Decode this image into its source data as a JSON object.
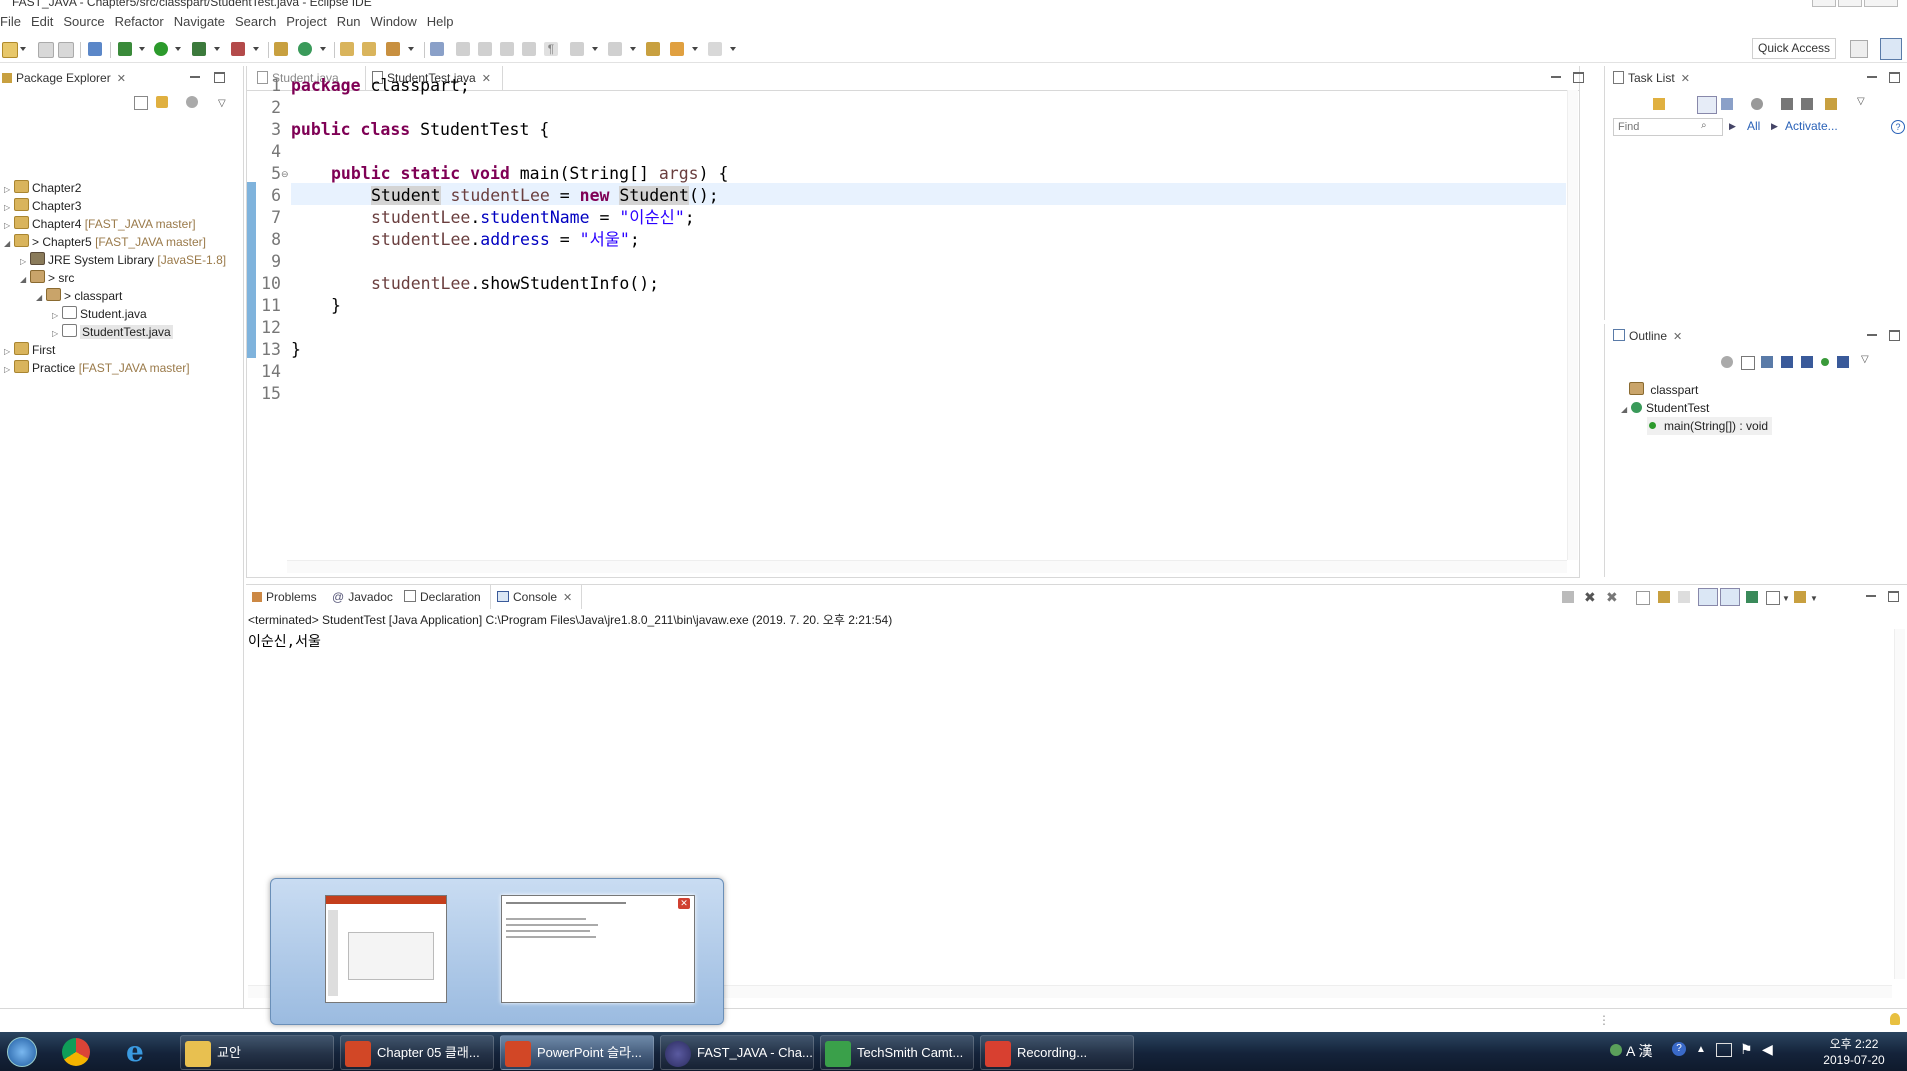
{
  "window": {
    "title": "FAST_JAVA - Chapter5/src/classpart/StudentTest.java - Eclipse IDE"
  },
  "menu": [
    "File",
    "Edit",
    "Source",
    "Refactor",
    "Navigate",
    "Search",
    "Project",
    "Run",
    "Window",
    "Help"
  ],
  "toolbar": {
    "quick_access": "Quick Access"
  },
  "package_explorer": {
    "title": "Package Explorer",
    "items": [
      {
        "label": "Chapter2",
        "repo": ""
      },
      {
        "label": "Chapter3",
        "repo": ""
      },
      {
        "label": "Chapter4",
        "repo": "[FAST_JAVA master]"
      },
      {
        "label": "> Chapter5",
        "repo": "[FAST_JAVA master]"
      },
      {
        "label": "JRE System Library",
        "repo": "[JavaSE-1.8]"
      },
      {
        "label": "> src",
        "repo": ""
      },
      {
        "label": "> classpart",
        "repo": ""
      },
      {
        "label": "Student.java",
        "repo": ""
      },
      {
        "label": "StudentTest.java",
        "repo": ""
      },
      {
        "label": "First",
        "repo": ""
      },
      {
        "label": "Practice",
        "repo": "[FAST_JAVA master]"
      }
    ]
  },
  "editor": {
    "tabs": [
      {
        "label": "Student.java"
      },
      {
        "label": "StudentTest.java"
      }
    ],
    "line_numbers": [
      "1",
      "2",
      "3",
      "4",
      "5",
      "6",
      "7",
      "8",
      "9",
      "10",
      "11",
      "12",
      "13",
      "14",
      "15"
    ],
    "code": {
      "l1_kw": "package",
      "l1_rest": " classpart;",
      "l3_kw": "public class",
      "l3_rest": " StudentTest {",
      "l5_kw": "public static void",
      "l5_mid": " main(String[] ",
      "l5_var": "args",
      "l5_end": ") {",
      "l7_type": "Student",
      "l7_var": "studentLee",
      "l7_eq": " = ",
      "l7_kw": "new",
      "l7_type2": "Student",
      "l7_end": "();",
      "l8_var": "studentLee",
      "l8_field": "studentName",
      "l8_eq": " = ",
      "l8_str": "\"이순신\"",
      "l8_end": ";",
      "l9_var": "studentLee",
      "l9_field": "address",
      "l9_eq": " = ",
      "l9_str": "\"서울\"",
      "l9_end": ";",
      "l11_var": "studentLee",
      "l11_call": ".showStudentInfo();",
      "l12": "}",
      "l14": "}"
    }
  },
  "task_list": {
    "title": "Task List",
    "find_placeholder": "Find",
    "all": "All",
    "activate": "Activate..."
  },
  "outline": {
    "title": "Outline",
    "package": "classpart",
    "class": "StudentTest",
    "method": "main(String[]) : void"
  },
  "console": {
    "tabs": [
      "Problems",
      "Javadoc",
      "Declaration",
      "Console"
    ],
    "status": "<terminated> StudentTest [Java Application] C:\\Program Files\\Java\\jre1.8.0_211\\bin\\javaw.exe (2019. 7. 20. 오후 2:21:54)",
    "output": "이순신,서울"
  },
  "taskbar": {
    "buttons": [
      {
        "label": "교안"
      },
      {
        "label": "Chapter 05 클래..."
      },
      {
        "label": "PowerPoint 슬라..."
      },
      {
        "label": "FAST_JAVA - Cha..."
      },
      {
        "label": "TechSmith Camt..."
      },
      {
        "label": "Recording..."
      }
    ],
    "tray": {
      "ime": "A 漢",
      "time": "오후 2:22",
      "date": "2019-07-20"
    }
  },
  "colors": {
    "keyword": "#7f0055",
    "string": "#2a00ff",
    "field": "#0000c0",
    "local_var": "#6a3e3e",
    "taskbar": "#14233a",
    "accent": "#3c7dc4"
  }
}
